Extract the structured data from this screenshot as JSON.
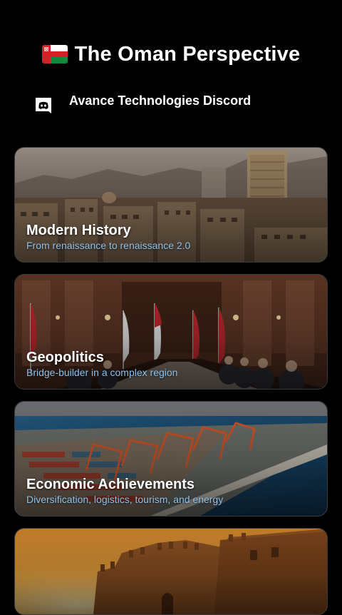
{
  "header": {
    "flag_icon": "oman-flag-icon",
    "title": "The Oman Perspective"
  },
  "discord": {
    "icon": "discord-icon",
    "label": "Avance Technologies Discord"
  },
  "cards": [
    {
      "title": "Modern History",
      "subtitle": "From renaissance to renaissance 2.0",
      "image": "city-skyline-photo"
    },
    {
      "title": "Geopolitics",
      "subtitle": "Bridge-builder in a complex region",
      "image": "diplomatic-meeting-photo"
    },
    {
      "title": "Economic Achievements",
      "subtitle": "Diversification, logistics, tourism, and energy",
      "image": "container-port-photo"
    },
    {
      "title": "",
      "subtitle": "",
      "image": "fort-sunset-photo"
    }
  ],
  "colors": {
    "background": "#000000",
    "subtitle": "#8fc2ea",
    "card_border": "#3a3a3a"
  }
}
